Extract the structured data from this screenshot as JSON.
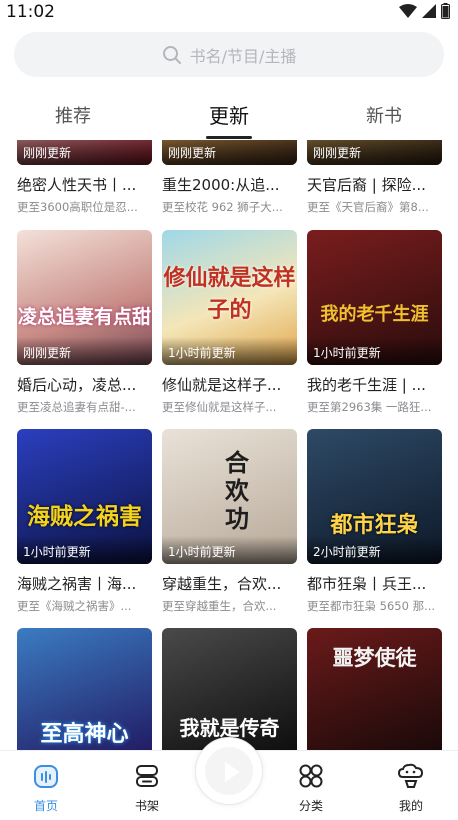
{
  "status_bar": {
    "time": "11:02"
  },
  "search": {
    "placeholder": "书名/节目/主播"
  },
  "tabs": [
    {
      "label": "推荐"
    },
    {
      "label": "更新"
    },
    {
      "label": "新书"
    }
  ],
  "books": [
    {
      "title": "绝密人性天书丨...",
      "desc": "更至3600高职位是忍...",
      "update": "刚刚更新",
      "cover_text": ""
    },
    {
      "title": "重生2000:从追...",
      "desc": "更至校花 962 狮子大...",
      "update": "刚刚更新",
      "cover_text": ""
    },
    {
      "title": "天官后裔 | 探险...",
      "desc": "更至《天官后裔》第8...",
      "update": "刚刚更新",
      "cover_text": ""
    },
    {
      "title": "婚后心动，凌总...",
      "desc": "更至凌总追妻有点甜-...",
      "update": "刚刚更新",
      "cover_text": "凌总追妻有点甜"
    },
    {
      "title": "修仙就是这样子...",
      "desc": "更至修仙就是这样子...",
      "update": "1小时前更新",
      "cover_text": "修仙就是这样子的"
    },
    {
      "title": "我的老千生涯 | ...",
      "desc": "更至第2963集 一路狂...",
      "update": "1小时前更新",
      "cover_text": "我的老千生涯"
    },
    {
      "title": "海贼之祸害丨海...",
      "desc": "更至《海贼之祸害》...",
      "update": "1小时前更新",
      "cover_text": "海贼之祸害"
    },
    {
      "title": "穿越重生，合欢...",
      "desc": "更至穿越重生，合欢...",
      "update": "1小时前更新",
      "cover_text": "合欢功"
    },
    {
      "title": "都市狂枭丨兵王...",
      "desc": "更至都市狂枭 5650 那...",
      "update": "2小时前更新",
      "cover_text": "都市狂枭"
    },
    {
      "title": "",
      "desc": "",
      "update": "",
      "cover_text": "至高神心"
    },
    {
      "title": "",
      "desc": "",
      "update": "",
      "cover_text": "我就是传奇"
    },
    {
      "title": "",
      "desc": "",
      "update": "",
      "cover_text": "噩梦使徒"
    }
  ],
  "bottom_nav": [
    {
      "label": "首页",
      "icon": "home-icon",
      "active": true
    },
    {
      "label": "书架",
      "icon": "bookshelf-icon"
    },
    {
      "label": "分类",
      "icon": "category-icon"
    },
    {
      "label": "我的",
      "icon": "profile-icon"
    }
  ],
  "colors": {
    "accent": "#3a8fe0",
    "text": "#222222",
    "muted": "#8a8c90",
    "search_bg": "#f2f3f5"
  }
}
